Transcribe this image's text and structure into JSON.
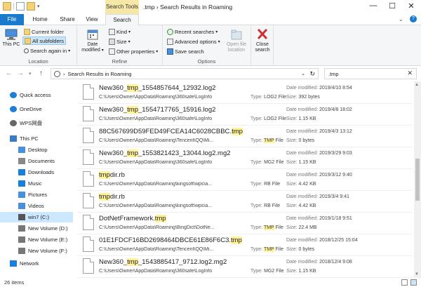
{
  "titlebar": {
    "context_label": "Search Tools",
    "title": ".tmp › Search Results in Roaming",
    "minimize": "—",
    "maximize": "☐",
    "close": "✕"
  },
  "tabs": [
    "File",
    "Home",
    "Share",
    "View",
    "Search"
  ],
  "ribbon": {
    "this_pc": "This PC",
    "current_folder": "Current folder",
    "all_subfolders": "All subfolders",
    "search_again_in": "Search again in",
    "location_group": "Location",
    "date_modified": "Date modified",
    "kind": "Kind",
    "size": "Size",
    "other_properties": "Other properties",
    "refine_group": "Refine",
    "recent_searches": "Recent searches",
    "advanced_options": "Advanced options",
    "save_search": "Save search",
    "open_file_location": "Open file location",
    "options_group": "Options",
    "close_search": "Close search"
  },
  "address": {
    "path": "Search Results in Roaming",
    "search_value": ".tmp"
  },
  "nav": [
    {
      "label": "Quick access",
      "icon": "star-icon",
      "color": "#1c7ed6"
    },
    {
      "label": "OneDrive",
      "icon": "cloud-icon",
      "color": "#1c7ed6"
    },
    {
      "label": "WPS网盘",
      "icon": "cloud-icon",
      "color": "#666666"
    },
    {
      "label": "This PC",
      "icon": "computer-icon",
      "color": "#3a7bc8"
    },
    {
      "label": "Desktop",
      "icon": "folder-icon",
      "color": "#4a90d9"
    },
    {
      "label": "Documents",
      "icon": "documents-icon",
      "color": "#888888"
    },
    {
      "label": "Downloads",
      "icon": "download-icon",
      "color": "#1c7ed6"
    },
    {
      "label": "Music",
      "icon": "music-icon",
      "color": "#1c7ed6"
    },
    {
      "label": "Pictures",
      "icon": "pictures-icon",
      "color": "#4a90d9"
    },
    {
      "label": "Videos",
      "icon": "videos-icon",
      "color": "#4a90d9"
    },
    {
      "label": "win7 (C:)",
      "icon": "drive-icon",
      "color": "#555555"
    },
    {
      "label": "New Volume (D:)",
      "icon": "drive-icon",
      "color": "#777777"
    },
    {
      "label": "New Volume (E:)",
      "icon": "drive-icon",
      "color": "#777777"
    },
    {
      "label": "New Volume (F:)",
      "icon": "drive-icon",
      "color": "#777777"
    },
    {
      "label": "Network",
      "icon": "network-icon",
      "color": "#1c7ed6"
    }
  ],
  "results": [
    {
      "pre": "New360_",
      "hl": "tmp",
      "post": "_1554857644_12932.log2",
      "path": "C:\\Users\\Owner\\AppData\\Roaming\\360safe\\LogInfo",
      "type_pre": "LOG2 File",
      "type_hl": "",
      "type_post": "",
      "date": "2019/4/10 8:54",
      "size": "392 bytes"
    },
    {
      "pre": "New360_",
      "hl": "tmp",
      "post": "_1554717765_15916.log2",
      "path": "C:\\Users\\Owner\\AppData\\Roaming\\360safe\\LogInfo",
      "type_pre": "LOG2 File",
      "type_hl": "",
      "type_post": "",
      "date": "2019/4/8 18:02",
      "size": "1.15 KB"
    },
    {
      "pre": "88C567699D59FED49FCEA14C6028CBBC.",
      "hl": "tmp",
      "post": "",
      "path": "C:\\Users\\Owner\\AppData\\Roaming\\Tencent\\QQ\\Mi...",
      "type_pre": "",
      "type_hl": "TMP",
      "type_post": " File",
      "date": "2019/4/3 13:12",
      "size": "0 bytes"
    },
    {
      "pre": "New360_",
      "hl": "tmp",
      "post": "_1553821423_13044.log2.mg2",
      "path": "C:\\Users\\Owner\\AppData\\Roaming\\360safe\\LogInfo",
      "type_pre": "MG2 File",
      "type_hl": "",
      "type_post": "",
      "date": "2019/3/29 9:03",
      "size": "1.15 KB"
    },
    {
      "pre": "",
      "hl": "tmp",
      "post": "dir.rb",
      "path": "C:\\Users\\Owner\\AppData\\Roaming\\kingsoft\\wps\\a...",
      "type_pre": "RB File",
      "type_hl": "",
      "type_post": "",
      "date": "2019/3/12 9:40",
      "size": "4.42 KB"
    },
    {
      "pre": "",
      "hl": "tmp",
      "post": "dir.rb",
      "path": "C:\\Users\\Owner\\AppData\\Roaming\\kingsoft\\wps\\a...",
      "type_pre": "RB File",
      "type_hl": "",
      "type_post": "",
      "date": "2019/3/4 9:41",
      "size": "4.42 KB"
    },
    {
      "pre": "DotNetFramework.",
      "hl": "tmp",
      "post": "",
      "path": "C:\\Users\\Owner\\AppData\\Roaming\\BingDict\\DotNe...",
      "type_pre": "",
      "type_hl": "TMP",
      "type_post": " File",
      "date": "2019/1/18 9:51",
      "size": "22.4 MB"
    },
    {
      "pre": "01E1FDCF16BD2698464DBCE61E86F6C3.",
      "hl": "tmp",
      "post": "",
      "path": "C:\\Users\\Owner\\AppData\\Roaming\\Tencent\\QQ\\Mi...",
      "type_pre": "",
      "type_hl": "TMP",
      "type_post": " File",
      "date": "2018/12/25 15:04",
      "size": "0 bytes"
    },
    {
      "pre": "New360_",
      "hl": "tmp",
      "post": "_1543885417_9712.log2.mg2",
      "path": "C:\\Users\\Owner\\AppData\\Roaming\\360safe\\LogInfo",
      "type_pre": "MG2 File",
      "type_hl": "",
      "type_post": "",
      "date": "2018/12/4 9:08",
      "size": "1.15 KB"
    }
  ],
  "labels": {
    "type": "Type:",
    "date_modified": "Date modified:",
    "size": "Size:"
  },
  "status": {
    "count": "26 items"
  },
  "colors": {
    "accent": "#1979ca",
    "highlight": "#fff39a",
    "context_tab": "#f7e7a6",
    "selected_nav": "#cce8ff"
  }
}
